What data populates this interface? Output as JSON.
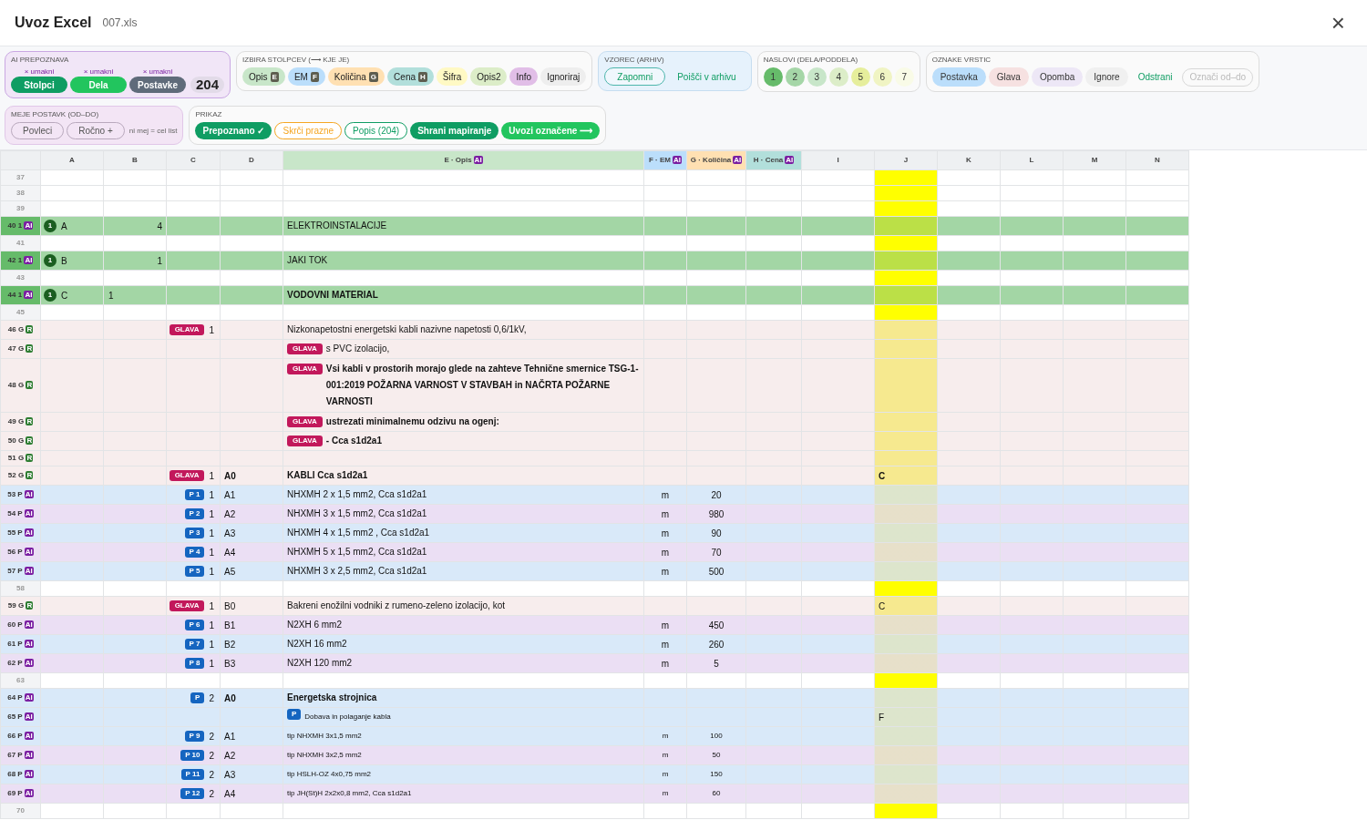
{
  "header": {
    "title": "Uvoz Excel",
    "file": "007.xls",
    "close": "×"
  },
  "ai_group": {
    "title": "AI PREPOZNAVA",
    "buttons": [
      {
        "undo": "× umakni",
        "label": "Stolpci",
        "color": "#0f9d63"
      },
      {
        "undo": "× umakni",
        "label": "Dela",
        "color": "#22c55e"
      },
      {
        "undo": "× umakni",
        "label": "Postavke",
        "color": "#5f6b7a"
      }
    ],
    "count": "204"
  },
  "column_pick": {
    "title": "IZBIRA STOLPCEV (⟶ KJE JE)",
    "chips": [
      {
        "label": "Opis",
        "key": "E",
        "color": "#c8e6c9"
      },
      {
        "label": "EM",
        "key": "F",
        "color": "#bbdefb"
      },
      {
        "label": "Količina",
        "key": "G",
        "color": "#ffe0b2"
      },
      {
        "label": "Cena",
        "key": "H",
        "color": "#b2dfdb"
      },
      {
        "label": "Šifra",
        "color": "#fff9c4"
      },
      {
        "label": "Opis2",
        "color": "#dcedc8"
      },
      {
        "label": "Info",
        "color": "#e1bee7"
      },
      {
        "label": "Ignoriraj",
        "color": "#eeeeee"
      }
    ]
  },
  "pattern": {
    "title": "VZOREC (ARHIV)",
    "buttons": [
      {
        "label": "Zapomni",
        "kind": "outline"
      },
      {
        "label": "Poišči v arhivu",
        "kind": "text"
      }
    ]
  },
  "headings": {
    "title": "NASLOVI (DELA/PODDELA)",
    "levels": [
      {
        "label": "1",
        "color": "#66bb6a"
      },
      {
        "label": "2",
        "color": "#a5d6a7"
      },
      {
        "label": "3",
        "color": "#c8e6c9"
      },
      {
        "label": "4",
        "color": "#dcedc8"
      },
      {
        "label": "5",
        "color": "#e6ee9c"
      },
      {
        "label": "6",
        "color": "#f0f4c3"
      },
      {
        "label": "7",
        "color": "#f9fbe7"
      }
    ]
  },
  "row_marks": {
    "title": "OZNAKE VRSTIC",
    "items": [
      {
        "label": "Postavka",
        "kind": "chip",
        "color": "#bbdefb"
      },
      {
        "label": "Glava",
        "kind": "chip",
        "color": "#f6e1e1"
      },
      {
        "label": "Opomba",
        "kind": "chip",
        "color": "#ede7f6"
      },
      {
        "label": "Ignore",
        "kind": "chip",
        "color": "#f0f0f0"
      },
      {
        "label": "Odstrani",
        "kind": "text"
      },
      {
        "label": "Označi od–do",
        "kind": "disabled"
      }
    ]
  },
  "limits": {
    "title": "MEJE POSTAVK (OD–DO)",
    "buttons": [
      "Povleci",
      "Ročno +"
    ],
    "note": "ni mej = cel list"
  },
  "view": {
    "title": "PRIKAZ",
    "buttons": [
      {
        "label": "Prepoznano ✓",
        "kind": "solid",
        "color": "#0f9d63"
      },
      {
        "label": "Skrči prazne",
        "kind": "outline",
        "color": "#f5a623"
      },
      {
        "label": "Popis (204)",
        "kind": "outline",
        "color": "#0f9d63"
      },
      {
        "label": "Shrani mapiranje",
        "kind": "solid",
        "color": "#0f9d63"
      },
      {
        "label": "Uvozi označene ⟶",
        "kind": "solid",
        "color": "#22c55e"
      }
    ]
  },
  "table": {
    "columns": [
      {
        "label": "A"
      },
      {
        "label": "B"
      },
      {
        "label": "C"
      },
      {
        "label": "D"
      },
      {
        "label": "E · Opis",
        "ai": "AI",
        "color": "#c8e6c9"
      },
      {
        "label": "F · EM",
        "ai": "AI",
        "color": "#bbdefb"
      },
      {
        "label": "G · Količina",
        "ai": "AI",
        "color": "#ffe0b2"
      },
      {
        "label": "H · Cena",
        "ai": "AI",
        "color": "#b2dfdb"
      },
      {
        "label": "I"
      },
      {
        "label": "J"
      },
      {
        "label": "K"
      },
      {
        "label": "L"
      },
      {
        "label": "M"
      },
      {
        "label": "N"
      }
    ],
    "rows": [
      {
        "num": "37",
        "kind": "blank"
      },
      {
        "num": "38",
        "kind": "blank"
      },
      {
        "num": "39",
        "kind": "blank"
      },
      {
        "num": "40",
        "type": "1",
        "badge": "AI",
        "kind": "heading",
        "color": "#a3d6a5",
        "level": "1",
        "a": "A",
        "b": "4",
        "e": "ELEKTROINSTALACIJE"
      },
      {
        "num": "41",
        "kind": "blank"
      },
      {
        "num": "42",
        "type": "1",
        "badge": "AI",
        "kind": "heading",
        "color": "#a3d6a5",
        "level": "1",
        "a": "B",
        "b": "1",
        "e": "JAKI TOK"
      },
      {
        "num": "43",
        "kind": "blank"
      },
      {
        "num": "44",
        "type": "1",
        "badge": "AI",
        "kind": "heading",
        "color": "#a3d6a5",
        "level": "1",
        "a": "C",
        "b": "1",
        "e": "VODOVNI MATERIAL",
        "bold": true,
        "b_left": true
      },
      {
        "num": "45",
        "kind": "blank"
      },
      {
        "num": "46",
        "type": "G",
        "badge": "R",
        "kind": "glava",
        "color": "#f7eded",
        "c_tag": "GLAVA",
        "c": "1",
        "e": "Nizkonapetostni energetski kabli nazivne napetosti 0,6/1kV,"
      },
      {
        "num": "47",
        "type": "G",
        "badge": "R",
        "kind": "glava",
        "color": "#f7eded",
        "e_tag": "GLAVA",
        "e": "s PVC izolacijo,"
      },
      {
        "num": "48",
        "type": "G",
        "badge": "R",
        "kind": "glava",
        "color": "#f7eded",
        "e_tag": "GLAVA",
        "e": "Vsi kabli v prostorih morajo glede na zahteve Tehnične smernice TSG-1-001:2019 POŽARNA VARNOST V STAVBAH in NAČRTA POŽARNE VARNOSTI",
        "bold": true
      },
      {
        "num": "49",
        "type": "G",
        "badge": "R",
        "kind": "glava",
        "color": "#f7eded",
        "e_tag": "GLAVA",
        "e": "ustrezati minimalnemu odzivu na ogenj:",
        "bold": true
      },
      {
        "num": "50",
        "type": "G",
        "badge": "R",
        "kind": "glava",
        "color": "#f7eded",
        "e_tag": "GLAVA",
        "e": "- Cca s1d2a1",
        "bold": true
      },
      {
        "num": "51",
        "type": "G",
        "badge": "R",
        "kind": "glava",
        "color": "#f7eded"
      },
      {
        "num": "52",
        "type": "G",
        "badge": "R",
        "kind": "glava",
        "color": "#f7eded",
        "c_tag": "GLAVA",
        "c": "1",
        "d": "A0",
        "e": "KABLI  Cca s1d2a1",
        "bold": true,
        "j": "C"
      },
      {
        "num": "53",
        "type": "P",
        "badge": "AI",
        "kind": "item",
        "color": "#d9e9f9",
        "c_tag": "P 1",
        "c": "1",
        "d": "A1",
        "e": "NHXMH 2 x 1,5 mm2, Cca s1d2a1",
        "f": "m",
        "g": "20"
      },
      {
        "num": "54",
        "type": "P",
        "badge": "AI",
        "kind": "item",
        "color": "#ebdff4",
        "c_tag": "P 2",
        "c": "1",
        "d": "A2",
        "e": "NHXMH 3 x 1,5 mm2, Cca s1d2a1",
        "f": "m",
        "g": "980"
      },
      {
        "num": "55",
        "type": "P",
        "badge": "AI",
        "kind": "item",
        "color": "#d9e9f9",
        "c_tag": "P 3",
        "c": "1",
        "d": "A3",
        "e": "NHXMH 4 x 1,5 mm2 , Cca s1d2a1",
        "f": "m",
        "g": "90"
      },
      {
        "num": "56",
        "type": "P",
        "badge": "AI",
        "kind": "item",
        "color": "#ebdff4",
        "c_tag": "P 4",
        "c": "1",
        "d": "A4",
        "e": "NHXMH 5 x 1,5 mm2, Cca s1d2a1",
        "f": "m",
        "g": "70"
      },
      {
        "num": "57",
        "type": "P",
        "badge": "AI",
        "kind": "item",
        "color": "#d9e9f9",
        "c_tag": "P 5",
        "c": "1",
        "d": "A5",
        "e": "NHXMH 3 x 2,5 mm2, Cca s1d2a1",
        "f": "m",
        "g": "500"
      },
      {
        "num": "58",
        "kind": "blank"
      },
      {
        "num": "59",
        "type": "G",
        "badge": "R",
        "kind": "glava",
        "color": "#f7eded",
        "c_tag": "GLAVA",
        "c": "1",
        "d": "B0",
        "e": "Bakreni enožilni vodniki z rumeno-zeleno izolacijo, kot",
        "j": "C"
      },
      {
        "num": "60",
        "type": "P",
        "badge": "AI",
        "kind": "item",
        "color": "#ebdff4",
        "c_tag": "P 6",
        "c": "1",
        "d": "B1",
        "e": "N2XH 6 mm2",
        "f": "m",
        "g": "450"
      },
      {
        "num": "61",
        "type": "P",
        "badge": "AI",
        "kind": "item",
        "color": "#d9e9f9",
        "c_tag": "P 7",
        "c": "1",
        "d": "B2",
        "e": "N2XH 16 mm2",
        "f": "m",
        "g": "260"
      },
      {
        "num": "62",
        "type": "P",
        "badge": "AI",
        "kind": "item",
        "color": "#ebdff4",
        "c_tag": "P 8",
        "c": "1",
        "d": "B3",
        "e": "N2XH 120 mm2",
        "f": "m",
        "g": "5"
      },
      {
        "num": "63",
        "kind": "blank"
      },
      {
        "num": "64",
        "type": "P",
        "badge": "AI",
        "kind": "item",
        "color": "#d9e9f9",
        "c_tag": "P",
        "c": "2",
        "d": "A0",
        "e": "Energetska strojnica",
        "bold": true
      },
      {
        "num": "65",
        "type": "P",
        "badge": "AI",
        "kind": "item",
        "color": "#d9e9f9",
        "e_tag": "P",
        "e": "Dobava in polaganje kabla",
        "small": true,
        "j": "F"
      },
      {
        "num": "66",
        "type": "P",
        "badge": "AI",
        "kind": "item",
        "color": "#d9e9f9",
        "c_tag": "P 9",
        "c": "2",
        "d": "A1",
        "e": "tip NHXMH 3x1,5 mm2",
        "f": "m",
        "g": "100",
        "small": true
      },
      {
        "num": "67",
        "type": "P",
        "badge": "AI",
        "kind": "item",
        "color": "#ebdff4",
        "c_tag": "P 10",
        "c": "2",
        "d": "A2",
        "e": "tip NHXMH 3x2,5 mm2",
        "f": "m",
        "g": "50",
        "small": true
      },
      {
        "num": "68",
        "type": "P",
        "badge": "AI",
        "kind": "item",
        "color": "#d9e9f9",
        "c_tag": "P 11",
        "c": "2",
        "d": "A3",
        "e": "tip HSLH-OZ 4x0,75 mm2",
        "f": "m",
        "g": "150",
        "small": true
      },
      {
        "num": "69",
        "type": "P",
        "badge": "AI",
        "kind": "item",
        "color": "#ebdff4",
        "c_tag": "P 12",
        "c": "2",
        "d": "A4",
        "e": "tip JH(St)H 2x2x0,8 mm2, Cca s1d2a1",
        "f": "m",
        "g": "60",
        "small": true
      },
      {
        "num": "70",
        "kind": "blank"
      }
    ]
  }
}
